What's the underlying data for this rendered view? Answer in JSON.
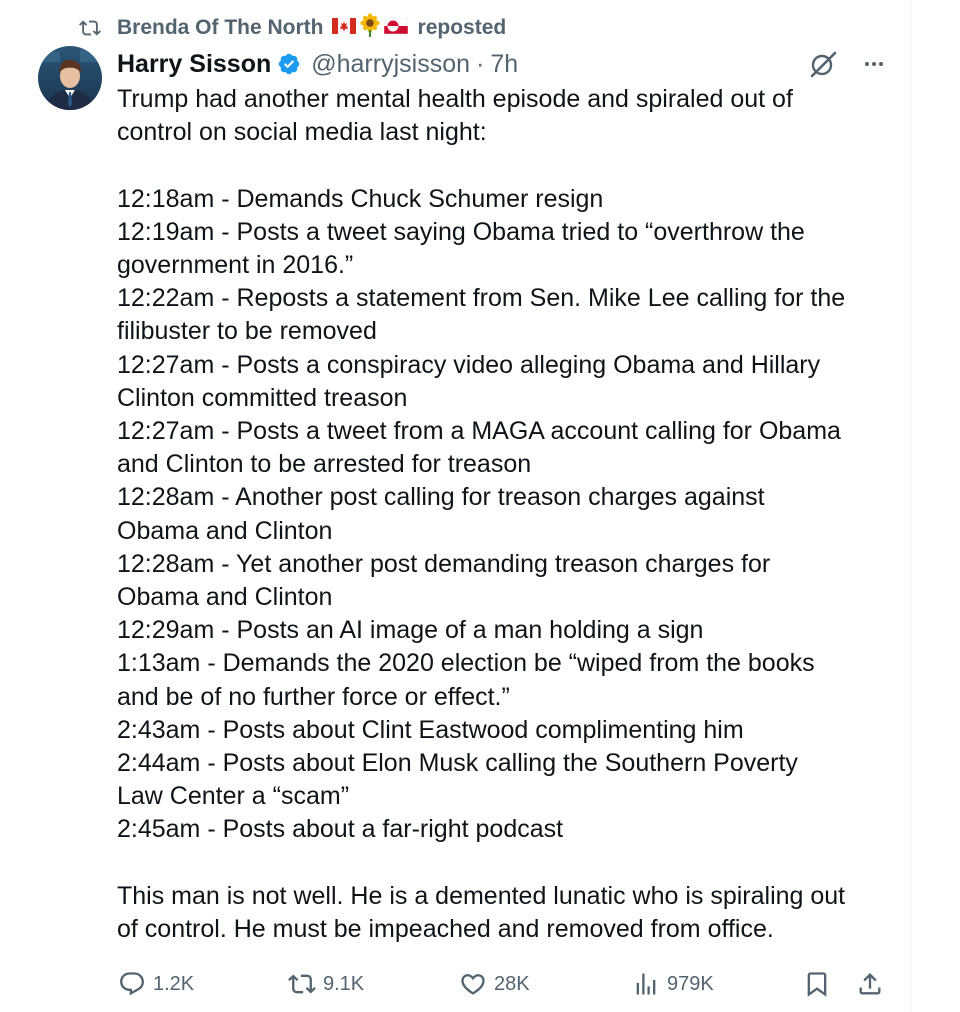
{
  "repost": {
    "icon": "repost-icon",
    "user": "Brenda Of The North",
    "flags": [
      "🇨🇦",
      "🌻",
      "🇬🇱"
    ],
    "label": "reposted"
  },
  "author": {
    "display_name": "Harry Sisson",
    "verified_icon": "verified-badge-icon",
    "handle": "@harryjsisson",
    "separator": "·",
    "time": "7h"
  },
  "tweet": {
    "intro": [
      "Trump had another mental health episode and spiraled out of",
      "control on social media last night:"
    ],
    "timeline": [
      [
        "12:18am - Demands Chuck Schumer resign"
      ],
      [
        "12:19am - Posts a tweet saying Obama tried to “overthrow the",
        "government in 2016.”"
      ],
      [
        "12:22am - Reposts a statement from Sen. Mike Lee calling for the",
        "filibuster to be removed"
      ],
      [
        "12:27am - Posts a conspiracy video alleging Obama and Hillary",
        "Clinton committed treason"
      ],
      [
        "12:27am - Posts a tweet from a MAGA account calling for Obama",
        "and Clinton to be arrested for treason"
      ],
      [
        "12:28am - Another post calling for treason charges against",
        "Obama and Clinton"
      ],
      [
        "12:28am - Yet another post demanding treason charges for",
        "Obama and Clinton"
      ],
      [
        "12:29am - Posts an AI image of a man holding a sign"
      ],
      [
        "1:13am - Demands the 2020 election be “wiped from the books",
        "and be of no further force or effect.”"
      ],
      [
        "2:43am - Posts about Clint Eastwood complimenting him"
      ],
      [
        "2:44am - Posts about Elon Musk calling the Southern Poverty",
        "Law Center a “scam”"
      ],
      [
        "2:45am - Posts about a far-right podcast"
      ]
    ],
    "closing": [
      "This man is not well. He is a demented lunatic who is spiraling out",
      "of control. He must be impeached and removed from office."
    ]
  },
  "actions": {
    "replies": "1.2K",
    "reposts": "9.1K",
    "likes": "28K",
    "views": "979K"
  },
  "colors": {
    "text": "#0f1419",
    "secondary": "#536471",
    "verified": "#1d9bf0"
  }
}
